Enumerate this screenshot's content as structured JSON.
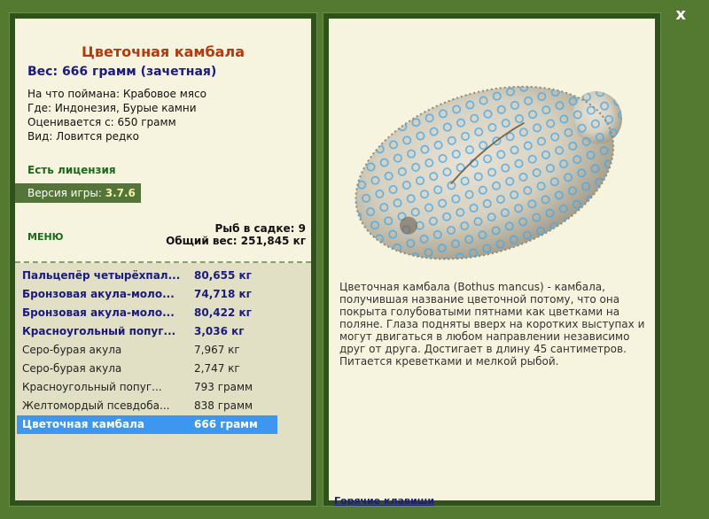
{
  "window": {
    "close_label": "x"
  },
  "fish": {
    "name": "Цветочная камбала",
    "weight_line": "Вес: 666 грамм (зачетная)",
    "bait": "На что поймана: Крабовое мясо",
    "location": "Где: Индонезия, Бурые камни",
    "value": "Оценивается с: 650 грамм",
    "rarity": "Вид: Ловится редко",
    "description": "Цветочная камбала (Bothus mancus) - камбала, получившая название цветочной потому, что она покрыта голубоватыми пятнами как цветками на поляне. Глаза подняты вверх на коротких выступах и могут двигаться в любом направлении независимо друг от друга. Достигает в длину 45 сантиметров. Питается креветками и мелкой рыбой."
  },
  "license": "Есть лицензия",
  "version": {
    "label": "Версия игры:",
    "value": "3.7.6"
  },
  "menu_label": "МЕНЮ",
  "stats": {
    "count": "Рыб в садке: 9",
    "total": "Общий вес: 251,845 кг"
  },
  "catch_list": [
    {
      "name": "Пальцепёр четырёхпал...",
      "weight": "80,655 кг",
      "style": "bold"
    },
    {
      "name": "Бронзовая акула-моло...",
      "weight": "74,718 кг",
      "style": "bold"
    },
    {
      "name": "Бронзовая акула-моло...",
      "weight": "80,422 кг",
      "style": "bold"
    },
    {
      "name": "Красноугольный попуг...",
      "weight": "3,036 кг",
      "style": "bold"
    },
    {
      "name": "Серо-бурая акула",
      "weight": "7,967 кг",
      "style": "normal"
    },
    {
      "name": "Серо-бурая акула",
      "weight": "2,747 кг",
      "style": "normal"
    },
    {
      "name": "Красноугольный попуг...",
      "weight": "793 грамм",
      "style": "normal"
    },
    {
      "name": "Желтомордый псевдоба...",
      "weight": "838 грамм",
      "style": "normal"
    },
    {
      "name": "Цветочная камбала",
      "weight": "666 грамм",
      "style": "sel"
    }
  ],
  "hotkeys_label": "Горячие клавиши",
  "colors": {
    "background": "#547a32",
    "panel": "#f6f3df",
    "list_bg": "#e1e0c4",
    "selected": "#3d97f0",
    "title": "#b23a10",
    "weight": "#1a1a80"
  }
}
